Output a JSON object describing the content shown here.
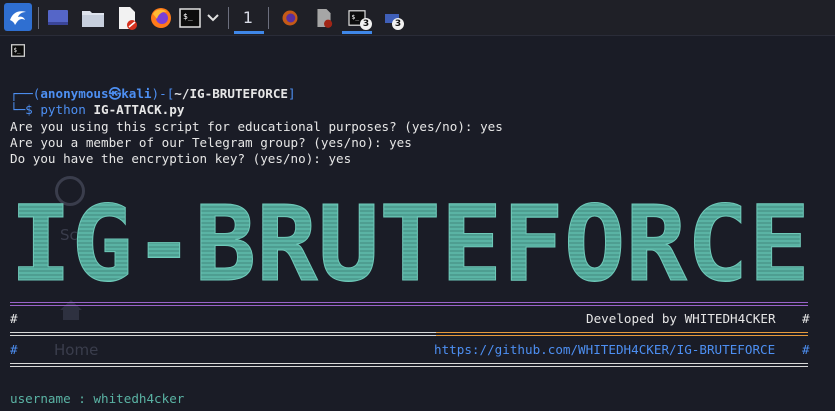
{
  "taskbar": {
    "workspace_number": "1",
    "terminal_count_badge": "3",
    "window_count_badge": "3"
  },
  "terminal": {
    "desktop_ghost": {
      "ghost_label_1": "Sc",
      "ghost_label_2": "Home"
    },
    "prompt": {
      "open_bracket": "┌──(",
      "user": "anonymous",
      "at_symbol": "㉿",
      "host": "kali",
      "mid": ")-[",
      "path": "~/IG-BRUTEFORCE",
      "close": "]",
      "second_line_prefix": "└─$ ",
      "command": "python",
      "argument": "IG-ATTACK.py"
    },
    "questions": [
      "Are you using this script for educational purposes? (yes/no): yes",
      "Are you a member of our Telegram group? (yes/no): yes",
      "Do you have the encryption key? (yes/no): yes"
    ],
    "banner_text": "IG-BRUTEFORCE",
    "developed_by": "Developed by WHITEDH4CKER",
    "github_url": "https://github.com/WHITEDH4CKER/IG-BRUTEFORCE",
    "hash": "#",
    "username_line": "username : whitedh4cker",
    "cut_line": "          ...   ."
  },
  "colors": {
    "accent_blue": "#4d8ff2",
    "banner_teal": "#5ab3a4",
    "purple_rule": "#9a63c9",
    "orange_rule": "#e59a3d"
  }
}
